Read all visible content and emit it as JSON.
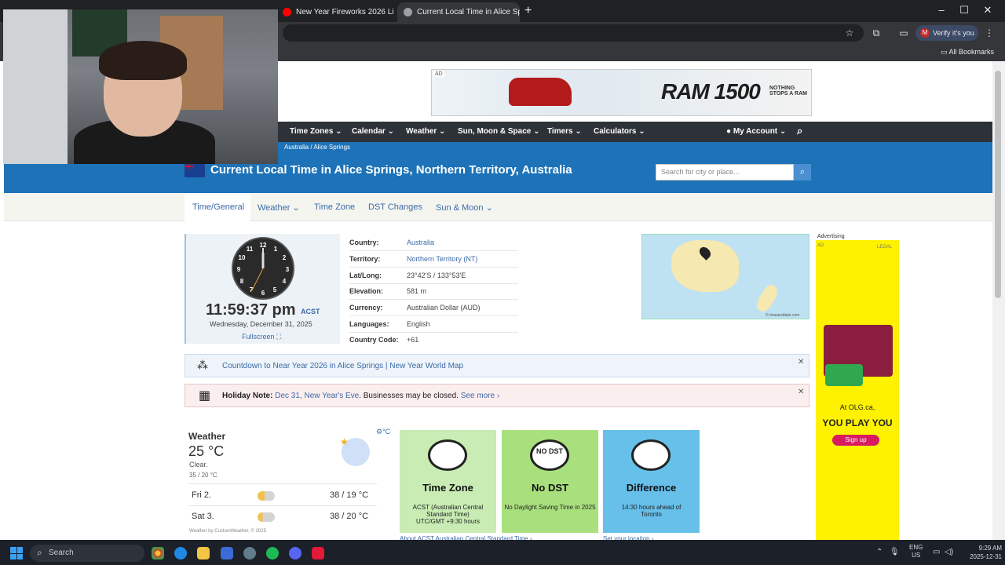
{
  "browser": {
    "tabs": [
      {
        "title": "New Year Fireworks 2026 Li",
        "favicon_color": "#ff0000"
      },
      {
        "title": "Current Local Time in Alice Spri",
        "favicon_color": "#8e8e8e"
      }
    ],
    "new_tab": "+",
    "verify_label": "Verify it's you",
    "verify_initial": "M",
    "bookmarks_label": "All Bookmarks"
  },
  "ad_top": {
    "label": "AD",
    "brand": "RAM 1500",
    "tagline": "NOTHING STOPS A RAM"
  },
  "nav": {
    "items": [
      "Time Zones ⌄",
      "Calendar ⌄",
      "Weather ⌄",
      "Sun, Moon & Space ⌄",
      "Timers ⌄",
      "Calculators ⌄"
    ],
    "account": "My Account ⌄"
  },
  "breadcrumb": [
    "Australia",
    "Alice Springs"
  ],
  "header": {
    "title": "Current Local Time in Alice Springs, Northern Territory, Australia",
    "search_placeholder": "Search for city or place..."
  },
  "subnav": [
    "Time/General",
    "Weather ⌄",
    "Time Zone",
    "DST Changes",
    "Sun & Moon ⌄"
  ],
  "clock": {
    "numbers": [
      "12",
      "1",
      "2",
      "3",
      "4",
      "5",
      "6",
      "7",
      "8",
      "9",
      "10",
      "11"
    ],
    "time": "11:59:37 pm",
    "tz": "ACST",
    "date": "Wednesday, December 31, 2025",
    "fullscreen": "Fullscreen ⛶"
  },
  "info": [
    {
      "label": "Country:",
      "value": "Australia",
      "link": true
    },
    {
      "label": "Territory:",
      "value": "Northern Territory (NT)",
      "link": true
    },
    {
      "label": "Lat/Long:",
      "value": "23°42'S / 133°53'E",
      "link": false
    },
    {
      "label": "Elevation:",
      "value": "581 m",
      "link": false
    },
    {
      "label": "Currency:",
      "value": "Australian Dollar (AUD)",
      "link": false
    },
    {
      "label": "Languages:",
      "value": "English",
      "link": false
    },
    {
      "label": "Country Code:",
      "value": "+61",
      "link": false
    }
  ],
  "map": {
    "copyright": "© timeanddate.com"
  },
  "ad_right": {
    "label": "Advertising",
    "adtag": "AD",
    "legal": "LEGAL",
    "at": "At OLG.ca,",
    "headline": "YOU PLAY YOU",
    "signup": "Sign up"
  },
  "countdown": {
    "text": "Countdown to Near Year 2026 in Alice Springs | New Year World Map"
  },
  "holiday": {
    "label": "Holiday Note:",
    "link": "Dec 31, New Year's Eve",
    "text": ". Businesses may be closed.",
    "more": "See more ›"
  },
  "weather": {
    "label": "Weather",
    "temp": "25 °C",
    "cond": "Clear.",
    "range": "35 / 20 °C",
    "unit": "⚙°C",
    "forecast": [
      {
        "day": "Fri 2.",
        "temp": "38 / 19 °C"
      },
      {
        "day": "Sat 3.",
        "temp": "38 / 20 °C"
      }
    ],
    "credit": "Weather by CustomWeather, © 2025"
  },
  "tiles": [
    {
      "title": "Time Zone",
      "desc": "ACST (Australian Central Standard Time)",
      "desc2": "UTC/GMT +9:30 hours"
    },
    {
      "title": "No DST",
      "icon_text": "NO DST",
      "desc": "No Daylight Saving Time in 2025",
      "desc2": ""
    },
    {
      "title": "Difference",
      "desc": "14:30 hours ahead of",
      "desc2": "Toronto"
    }
  ],
  "tile_links": {
    "a": "About ACST     Australian Central Standard Time ›",
    "b": "Set your location ›"
  },
  "taskbar": {
    "search": "Search",
    "lang": [
      "ENG",
      "US"
    ],
    "time": "9:29 AM",
    "date": "2025-12-31"
  }
}
